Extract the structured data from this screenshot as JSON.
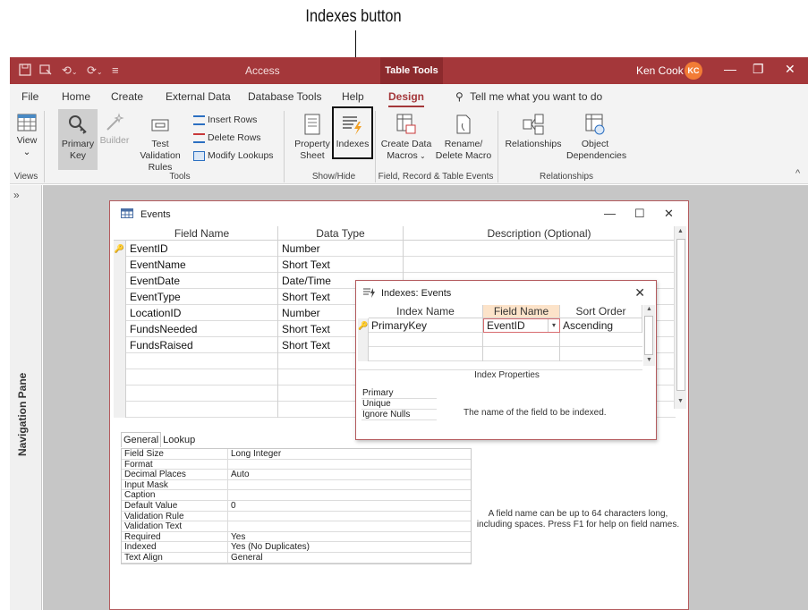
{
  "callout": {
    "label": "Indexes button"
  },
  "titlebar": {
    "app_name": "Access",
    "contextual_tab": "Table Tools",
    "user_name": "Ken Cook",
    "user_initials": "KC",
    "qat_icons": [
      "save-icon",
      "touch-mode-icon",
      "undo-icon",
      "redo-icon",
      "customize-qat-icon"
    ],
    "window_controls": [
      "minimize-icon",
      "restore-icon",
      "close-icon"
    ]
  },
  "menu": {
    "tabs": [
      "File",
      "Home",
      "Create",
      "External Data",
      "Database Tools",
      "Help",
      "Design"
    ],
    "active_tab": "Design",
    "tell_me": "Tell me what you want to do"
  },
  "ribbon": {
    "views": {
      "view_label": "View",
      "group": "Views"
    },
    "tools": {
      "primary_key": "Primary Key",
      "builder": "Builder",
      "test_validation": "Test Validation Rules",
      "insert_rows": "Insert Rows",
      "delete_rows": "Delete Rows",
      "modify_lookups": "Modify Lookups",
      "group": "Tools"
    },
    "show_hide": {
      "property_sheet": "Property Sheet",
      "indexes": "Indexes",
      "group": "Show/Hide"
    },
    "field_events": {
      "create_data_macros": "Create Data Macros",
      "rename_delete_macro": "Rename/ Delete Macro",
      "group": "Field, Record & Table Events"
    },
    "relationships": {
      "relationships": "Relationships",
      "object_dependencies": "Object Dependencies",
      "group": "Relationships"
    }
  },
  "nav_pane": {
    "label": "Navigation Pane",
    "toggle": "»"
  },
  "table_window": {
    "title": "Events",
    "headers": [
      "Field Name",
      "Data Type",
      "Description (Optional)"
    ],
    "fields": [
      {
        "name": "EventID",
        "type": "Number",
        "key": true
      },
      {
        "name": "EventName",
        "type": "Short Text",
        "key": false
      },
      {
        "name": "EventDate",
        "type": "Date/Time",
        "key": false
      },
      {
        "name": "EventType",
        "type": "Short Text",
        "key": false
      },
      {
        "name": "LocationID",
        "type": "Number",
        "key": false
      },
      {
        "name": "FundsNeeded",
        "type": "Short Text",
        "key": false
      },
      {
        "name": "FundsRaised",
        "type": "Short Text",
        "key": false
      }
    ],
    "prop_tabs": [
      "General",
      "Lookup"
    ],
    "field_properties": [
      {
        "name": "Field Size",
        "value": "Long Integer"
      },
      {
        "name": "Format",
        "value": ""
      },
      {
        "name": "Decimal Places",
        "value": "Auto"
      },
      {
        "name": "Input Mask",
        "value": ""
      },
      {
        "name": "Caption",
        "value": ""
      },
      {
        "name": "Default Value",
        "value": "0"
      },
      {
        "name": "Validation Rule",
        "value": ""
      },
      {
        "name": "Validation Text",
        "value": ""
      },
      {
        "name": "Required",
        "value": "Yes"
      },
      {
        "name": "Indexed",
        "value": "Yes (No Duplicates)"
      },
      {
        "name": "Text Align",
        "value": "General"
      }
    ],
    "help_text": "A field name can be up to 64 characters long, including spaces. Press F1 for help on field names."
  },
  "indexes_window": {
    "title": "Indexes: Events",
    "headers": [
      "Index Name",
      "Field Name",
      "Sort Order"
    ],
    "rows": [
      {
        "index_name": "PrimaryKey",
        "field_name": "EventID",
        "sort_order": "Ascending"
      }
    ],
    "properties_title": "Index Properties",
    "properties": [
      "Primary",
      "Unique",
      "Ignore Nulls"
    ],
    "help_text": "The name of the field to be indexed."
  },
  "colors": {
    "accent": "#a4373a",
    "field_header_highlight": "#fce3c9"
  }
}
